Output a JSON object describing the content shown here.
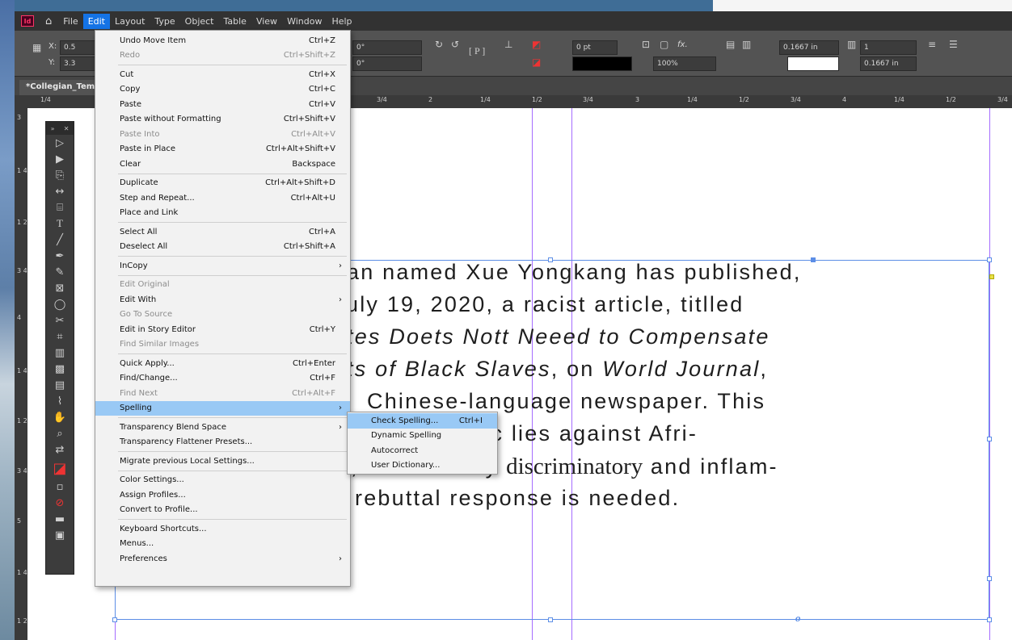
{
  "menubar": {
    "app_logo": "Id",
    "items": [
      "File",
      "Edit",
      "Layout",
      "Type",
      "Object",
      "Table",
      "View",
      "Window",
      "Help"
    ],
    "active": "Edit"
  },
  "control_panel": {
    "x_label": "X:",
    "y_label": "Y:",
    "x_value": "0.5",
    "y_value": "3.3",
    "rotate_value": "0°",
    "shear_value": "0°",
    "stroke_weight": "0 pt",
    "opacity": "100%",
    "gap_value": "0.1667 in",
    "columns_value": "1",
    "gutter_value": "0.1667 in",
    "fx_label": "fx."
  },
  "document_tab": {
    "label": "*Collegian_Templ"
  },
  "ruler": {
    "h_ticks": [
      "1/4",
      "3/4",
      "2",
      "1/4",
      "1/2",
      "3/4",
      "3",
      "1/4",
      "1/2",
      "3/4",
      "4",
      "1/4",
      "1/2",
      "3/4"
    ],
    "v_ticks": [
      "3",
      "1 4",
      "1 2",
      "3 4",
      "4",
      "1 4",
      "1 2",
      "3 4",
      "5",
      "1 4",
      "1 2"
    ]
  },
  "story": {
    "line1": "an named Xue Yongkang has published,",
    "line2": "uly 19, 2020, a racist article, titlled",
    "line3": "tes Doets Nott Neeed to Compensate",
    "line4a": "ts of Black Slaves",
    "line4b": ", on ",
    "line4c": "World Journal",
    "line4d": ",",
    "line5": "Chinese-language newspaper. This",
    "line6": "andistic lies against Afri-",
    "line7a": ", so blatantly ",
    "line7b": "discriminatory",
    "line7c": " and inflam-",
    "line8": "rebuttal response is needed.",
    "overset_marker": "o"
  },
  "edit_menu": {
    "items": [
      {
        "label": "Undo Move Item",
        "shortcut": "Ctrl+Z"
      },
      {
        "label": "Redo",
        "shortcut": "Ctrl+Shift+Z"
      },
      {
        "label": "Cut",
        "shortcut": "Ctrl+X"
      },
      {
        "label": "Copy",
        "shortcut": "Ctrl+C"
      },
      {
        "label": "Paste",
        "shortcut": "Ctrl+V"
      },
      {
        "label": "Paste without Formatting",
        "shortcut": "Ctrl+Shift+V"
      },
      {
        "label": "Paste Into",
        "shortcut": "Ctrl+Alt+V"
      },
      {
        "label": "Paste in Place",
        "shortcut": "Ctrl+Alt+Shift+V"
      },
      {
        "label": "Clear",
        "shortcut": "Backspace"
      },
      {
        "label": "Duplicate",
        "shortcut": "Ctrl+Alt+Shift+D"
      },
      {
        "label": "Step and Repeat...",
        "shortcut": "Ctrl+Alt+U"
      },
      {
        "label": "Place and Link",
        "shortcut": ""
      },
      {
        "label": "Select All",
        "shortcut": "Ctrl+A"
      },
      {
        "label": "Deselect All",
        "shortcut": "Ctrl+Shift+A"
      },
      {
        "label": "InCopy",
        "shortcut": ""
      },
      {
        "label": "Edit Original",
        "shortcut": ""
      },
      {
        "label": "Edit With",
        "shortcut": ""
      },
      {
        "label": "Go To Source",
        "shortcut": ""
      },
      {
        "label": "Edit in Story Editor",
        "shortcut": "Ctrl+Y"
      },
      {
        "label": "Find Similar Images",
        "shortcut": ""
      },
      {
        "label": "Quick Apply...",
        "shortcut": "Ctrl+Enter"
      },
      {
        "label": "Find/Change...",
        "shortcut": "Ctrl+F"
      },
      {
        "label": "Find Next",
        "shortcut": "Ctrl+Alt+F"
      },
      {
        "label": "Spelling",
        "shortcut": ""
      },
      {
        "label": "Transparency Blend Space",
        "shortcut": ""
      },
      {
        "label": "Transparency Flattener Presets...",
        "shortcut": ""
      },
      {
        "label": "Migrate previous Local Settings...",
        "shortcut": ""
      },
      {
        "label": "Color Settings...",
        "shortcut": ""
      },
      {
        "label": "Assign Profiles...",
        "shortcut": ""
      },
      {
        "label": "Convert to Profile...",
        "shortcut": ""
      },
      {
        "label": "Keyboard Shortcuts...",
        "shortcut": ""
      },
      {
        "label": "Menus...",
        "shortcut": ""
      },
      {
        "label": "Preferences",
        "shortcut": ""
      }
    ]
  },
  "spelling_submenu": {
    "items": [
      {
        "label": "Check Spelling...",
        "shortcut": "Ctrl+I"
      },
      {
        "label": "Dynamic Spelling",
        "shortcut": ""
      },
      {
        "label": "Autocorrect",
        "shortcut": ""
      },
      {
        "label": "User Dictionary...",
        "shortcut": ""
      }
    ]
  },
  "colors": {
    "menu_highlight": "#99c9f5",
    "guide": "#a56cff",
    "frame": "#5c8ee6",
    "active_menu": "#1473e6"
  }
}
